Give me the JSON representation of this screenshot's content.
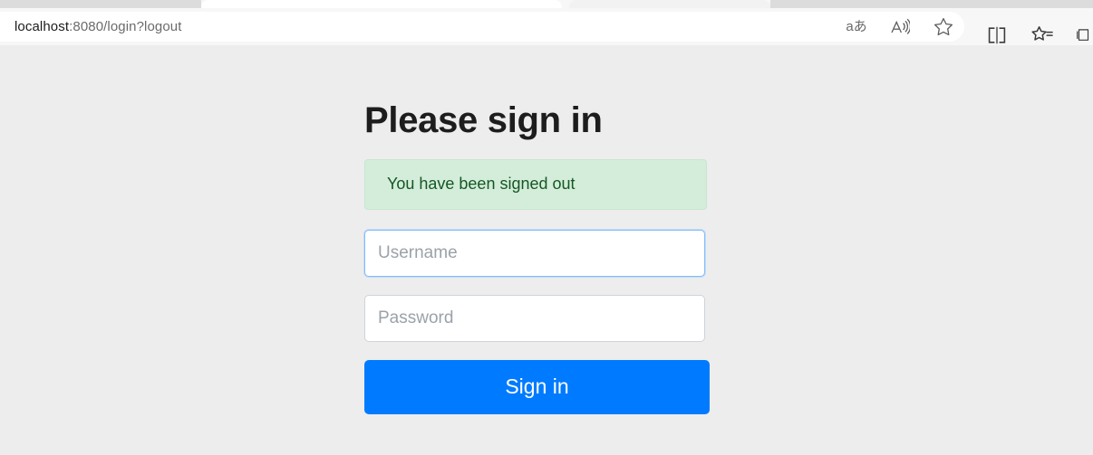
{
  "browser": {
    "url_bar": {
      "host": "localhost",
      "path": ":8080/login?logout",
      "full_url": "localhost:8080/login?logout"
    },
    "url_actions": [
      {
        "name": "translate-icon",
        "glyph": "aあ",
        "label": "Translate"
      },
      {
        "name": "read-aloud-icon",
        "label": "Read aloud"
      },
      {
        "name": "favorite-star-icon",
        "label": "Add this page to favorites"
      }
    ],
    "toolbar_actions": [
      {
        "name": "split-screen-icon",
        "label": "Split screen"
      },
      {
        "name": "favorites-list-icon",
        "label": "Favorites"
      },
      {
        "name": "collections-icon",
        "label": "Collections"
      }
    ]
  },
  "page": {
    "title": "Please sign in",
    "alert": {
      "message": "You have been signed out",
      "type": "success",
      "background": "#d4edda",
      "text_color": "#155724"
    },
    "form": {
      "username": {
        "value": "",
        "placeholder": "Username",
        "focused": true
      },
      "password": {
        "value": "",
        "placeholder": "Password",
        "focused": false
      },
      "submit_label": "Sign in",
      "submit_color": "#007bff"
    },
    "background_color": "#ededed"
  }
}
